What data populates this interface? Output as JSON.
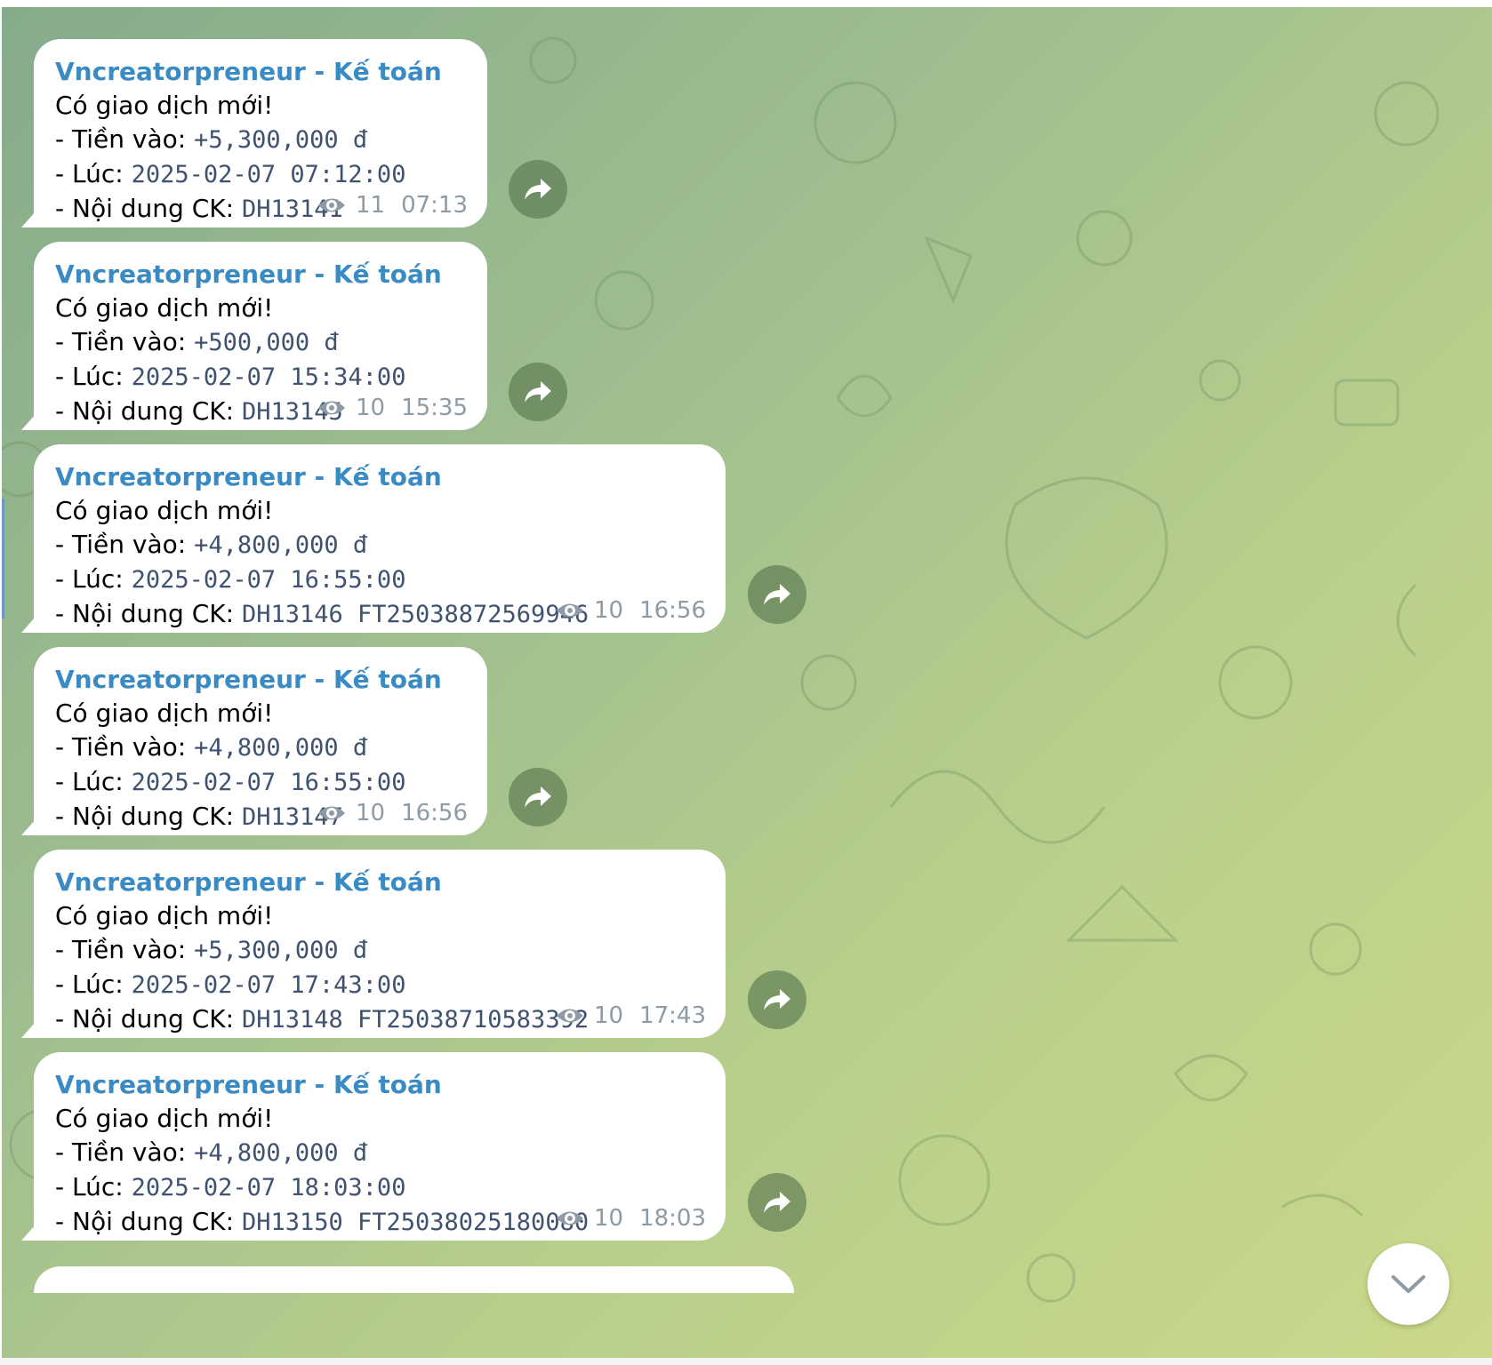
{
  "messages": [
    {
      "sender": "Vncreatorpreneur - Kế toán",
      "heading": "Có giao dịch mới!",
      "in_label": "- Tiền vào: ",
      "amount": "+5,300,000 đ",
      "time_label": "- Lúc: ",
      "datetime": "2025-02-07 07:12:00",
      "content_label": "- Nội dung CK: ",
      "content": "DH13141",
      "views": "11",
      "sent_time": "07:13"
    },
    {
      "sender": "Vncreatorpreneur - Kế toán",
      "heading": "Có giao dịch mới!",
      "in_label": "- Tiền vào: ",
      "amount": "+500,000 đ",
      "time_label": "- Lúc: ",
      "datetime": "2025-02-07 15:34:00",
      "content_label": "- Nội dung CK: ",
      "content": "DH13145",
      "views": "10",
      "sent_time": "15:35"
    },
    {
      "sender": "Vncreatorpreneur - Kế toán",
      "heading": "Có giao dịch mới!",
      "in_label": "- Tiền vào: ",
      "amount": "+4,800,000 đ",
      "time_label": "- Lúc: ",
      "datetime": "2025-02-07 16:55:00",
      "content_label": "- Nội dung CK: ",
      "content": "DH13146 FT25038872569946",
      "views": "10",
      "sent_time": "16:56"
    },
    {
      "sender": "Vncreatorpreneur - Kế toán",
      "heading": "Có giao dịch mới!",
      "in_label": "- Tiền vào: ",
      "amount": "+4,800,000 đ",
      "time_label": "- Lúc: ",
      "datetime": "2025-02-07 16:55:00",
      "content_label": "- Nội dung CK: ",
      "content": "DH13147",
      "views": "10",
      "sent_time": "16:56"
    },
    {
      "sender": "Vncreatorpreneur - Kế toán",
      "heading": "Có giao dịch mới!",
      "in_label": "- Tiền vào: ",
      "amount": "+5,300,000 đ",
      "time_label": "- Lúc: ",
      "datetime": "2025-02-07 17:43:00",
      "content_label": "- Nội dung CK: ",
      "content": "DH13148 FT25038710583392",
      "views": "10",
      "sent_time": "17:43"
    },
    {
      "sender": "Vncreatorpreneur - Kế toán",
      "heading": "Có giao dịch mới!",
      "in_label": "- Tiền vào: ",
      "amount": "+4,800,000 đ",
      "time_label": "- Lúc: ",
      "datetime": "2025-02-07 18:03:00",
      "content_label": "- Nội dung CK: ",
      "content": "DH13150 FT25038025180080",
      "views": "10",
      "sent_time": "18:03"
    }
  ],
  "icons": {
    "views": "eye-icon",
    "forward": "forward-arrow-icon",
    "scroll": "chevron-down-icon"
  },
  "colors": {
    "sender": "#3a8ac4",
    "mono_text": "#3f5270",
    "meta": "#8e9aa4",
    "forward_bg": "#5a7850"
  }
}
